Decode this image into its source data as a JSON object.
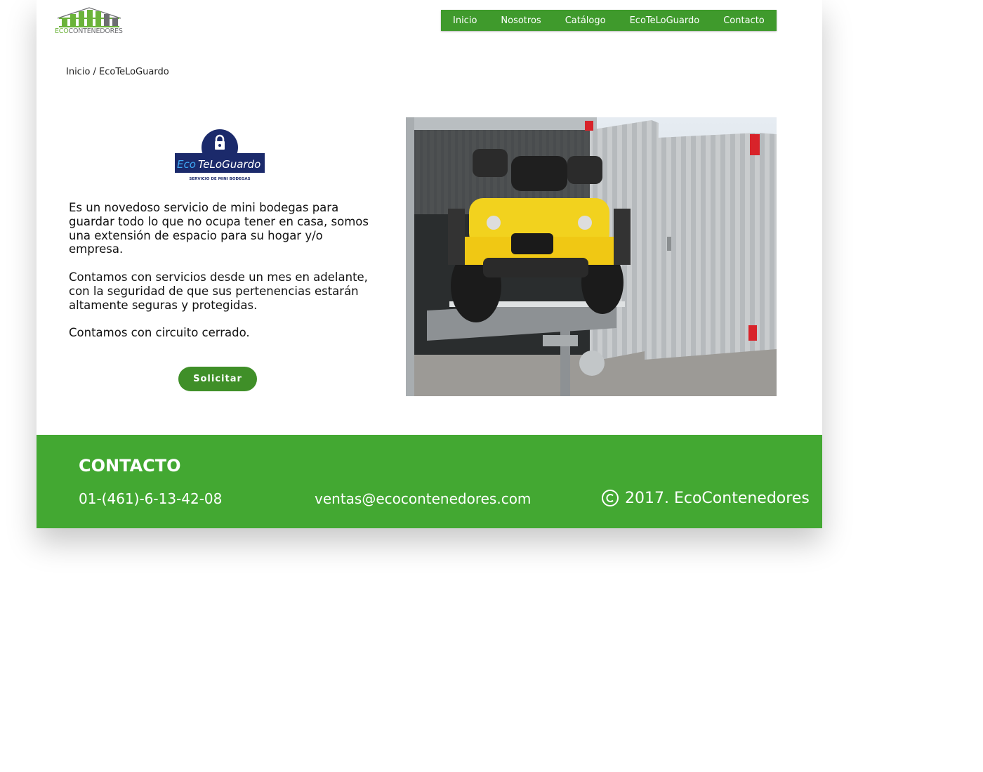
{
  "header": {
    "logo": {
      "eco": "ECO",
      "rest": "CONTENEDORES"
    },
    "nav": [
      "Inicio",
      "Nosotros",
      "Catálogo",
      "EcoTeLoGuardo",
      "Contacto"
    ]
  },
  "breadcrumb": "Inicio / EcoTeLoGuardo",
  "brand": {
    "eco": "Eco",
    "name": "TeLoGuardo",
    "tagline": "SERVICIO DE MINI BODEGAS",
    "color": "#1b2a6b"
  },
  "main": {
    "paragraphs": [
      "Es un novedoso servicio de mini bodegas para guardar todo lo que no ocupa tener en casa, somos una extensión de espacio para su hogar y/o empresa.",
      "Contamos con servicios desde un mes en adelante, con la seguridad de que sus pertenencias estarán altamente seguras y protegidas.",
      "Contamos con circuito cerrado."
    ],
    "button": "Solicitar",
    "photo_icon": "atv-in-storage-container-photo"
  },
  "footer": {
    "title": "CONTACTO",
    "phone": "01-(461)-6-13-42-08",
    "email": "ventas@ecocontenedores.com",
    "copyright": "2017. EcoContenedores",
    "bg_color": "#43a832"
  },
  "colors": {
    "accent": "#3f9a2c",
    "brand_navy": "#1b2a6b",
    "atv_yellow": "#f2d21e"
  }
}
